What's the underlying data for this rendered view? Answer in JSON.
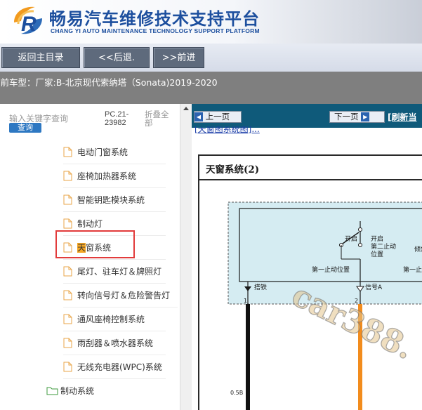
{
  "header": {
    "logo_letter": "R",
    "title_zh": "畅易汽车维修技术支持平台",
    "title_en": "CHANG YI AUTO MAINTENANCE TECHNOLOGY SUPPORT PLATFORM"
  },
  "nav": {
    "back_main": "返回主目录",
    "back": "<<后退.",
    "forward": ">>前进"
  },
  "model_bar": {
    "text": "当前车型：厂家:B-北京现代索纳塔（Sonata)2019-2020"
  },
  "sidebar": {
    "search_placeholder": "输入关键字查询",
    "search_button": "查询",
    "pc_code_line1": "PC.21-",
    "pc_code_line2": "23982",
    "collapse_all": "折叠全部",
    "items": [
      {
        "label": "电动门窗系统",
        "icon": "document-icon"
      },
      {
        "label": "座椅加热器系统",
        "icon": "document-icon"
      },
      {
        "label": "智能钥匙模块系统",
        "icon": "document-icon"
      },
      {
        "label": "制动灯",
        "icon": "document-icon"
      },
      {
        "label_highlight": "天",
        "label_rest": "窗系统",
        "icon": "document-icon",
        "selected": true
      },
      {
        "label": "尾灯、驻车灯＆牌照灯",
        "icon": "document-icon"
      },
      {
        "label": "转向信号灯＆危险警告灯",
        "icon": "document-icon"
      },
      {
        "label": "通风座椅控制系统",
        "icon": "document-icon"
      },
      {
        "label": "雨刮器＆喷水器系统",
        "icon": "document-icon"
      },
      {
        "label": "无线充电器(WPC)系统",
        "icon": "document-icon"
      },
      {
        "label": "制动系统",
        "icon": "folder-icon"
      }
    ],
    "highlight_color": "#f5a623",
    "selection_box_color": "#e23b3b"
  },
  "doc": {
    "prev_page": "上一页",
    "next_page": "下一页",
    "refresh": "[刷新当",
    "top_link": "[天窗图系统图]...",
    "frame_title": "天窗系统(2)",
    "diagram": {
      "label_open": "开启",
      "label_open2": "开启",
      "label_stop2": "第二止动",
      "label_position": "位置",
      "label_tilt": "倾斜",
      "label_first_stop": "第一止动位置",
      "label_first_stop_right": "第一止动",
      "label_ground": "搭铁",
      "label_signal": "信号A",
      "pin1": "1",
      "pin2": "2",
      "wire_size": "0.5B",
      "edge_char": "关"
    },
    "toolbar_color": "#0f5a7a"
  },
  "watermark": {
    "text": "car388."
  }
}
